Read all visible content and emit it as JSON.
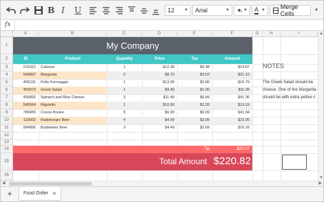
{
  "toolbar": {
    "font_size": "12",
    "font_name": "Arial",
    "merge_cells_label": "Merge Cells"
  },
  "formula_bar": {
    "label": "fx",
    "value": ""
  },
  "columns": [
    "A",
    "B",
    "C",
    "D",
    "E",
    "F",
    "G",
    "H",
    "I"
  ],
  "rows": [
    "1",
    "2",
    "3",
    "4",
    "5",
    "6",
    "7",
    "8",
    "9",
    "10",
    "11",
    "12",
    "13",
    "14",
    "15",
    "16"
  ],
  "sheet": {
    "company": "My Company",
    "headers": [
      "ID",
      "Product",
      "Quantity",
      "Price",
      "Tax",
      "Amount"
    ],
    "items": [
      {
        "id": "216321",
        "product": "Calzone",
        "qty": "1",
        "price": "$12.39",
        "tax": "$2.48",
        "amount": "$14.87"
      },
      {
        "id": "546897",
        "product": "Margarita",
        "qty": "2",
        "price": "$8.79",
        "tax": "$3.52",
        "amount": "$21.10"
      },
      {
        "id": "456231",
        "product": "Pollo Formaggio",
        "qty": "1",
        "price": "$13.99",
        "tax": "$2.80",
        "amount": "$16.79"
      },
      {
        "id": "455873",
        "product": "Greek Salad",
        "qty": "1",
        "price": "$9.49",
        "tax": "$1.90",
        "amount": "$11.39"
      },
      {
        "id": "456892",
        "product": "Spinach and Blue Cheese",
        "qty": "3",
        "price": "$11.49",
        "tax": "$6.89",
        "amount": "$41.36"
      },
      {
        "id": "546564",
        "product": "Rigoletto",
        "qty": "1",
        "price": "$10.99",
        "tax": "$2.20",
        "amount": "$13.19"
      },
      {
        "id": "789455",
        "product": "Creme Brulee",
        "qty": "5",
        "price": "$6.99",
        "tax": "$6.99",
        "amount": "$41.94"
      },
      {
        "id": "123002",
        "product": "Radeberger Beer",
        "qty": "4",
        "price": "$4.99",
        "tax": "$3.99",
        "amount": "$23.95"
      },
      {
        "id": "564896",
        "product": "Budweiser Beer",
        "qty": "3",
        "price": "$4.49",
        "tax": "$2.69",
        "amount": "$16.16"
      }
    ],
    "tip_label": "Tip",
    "tip_value": "$20.07",
    "total_label": "Total Amount",
    "total_value": "$220.82"
  },
  "notes": {
    "title": "NOTES",
    "lines": [
      "The Greek Salad should be",
      "cheese. One of the Margarita",
      "should be with extra yellow c"
    ]
  },
  "tabs": [
    {
      "label": "Food Order"
    }
  ],
  "colors": {
    "header_bg": "#5b6169",
    "column_header_bg": "#3fc6c5",
    "row_stripe": "#efefef",
    "row_highlight": "#fde5c8",
    "tip_bg": "#ff6b6b",
    "total_bg": "#d9485a"
  },
  "icons": [
    "undo-icon",
    "redo-icon",
    "save-icon",
    "bold-icon",
    "italic-icon",
    "underline-icon",
    "align-left-icon",
    "align-center-icon",
    "align-right-icon",
    "align-top-icon",
    "align-middle-icon",
    "fill-color-icon",
    "font-color-icon",
    "merge-cells-icon",
    "add-sheet-icon",
    "close-tab-icon"
  ]
}
